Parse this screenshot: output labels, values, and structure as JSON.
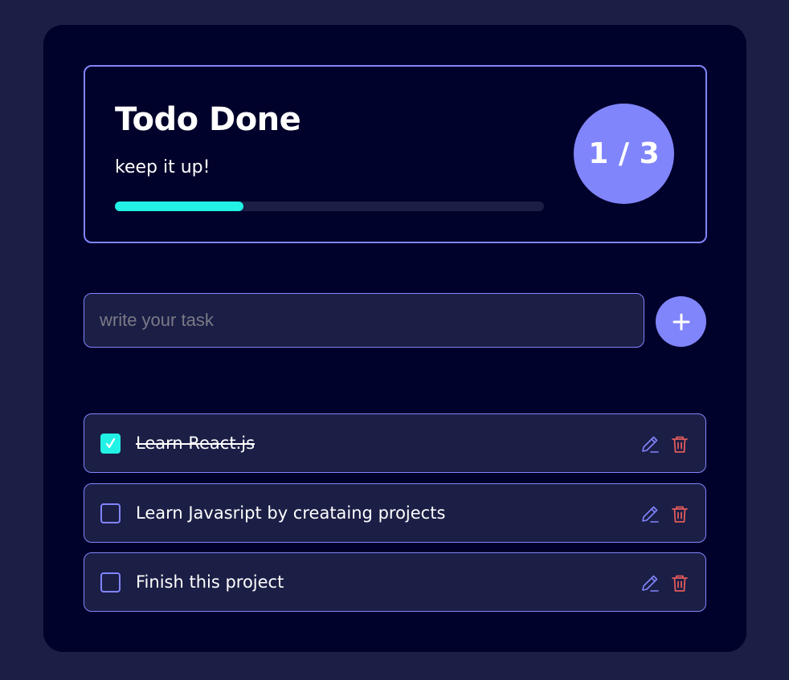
{
  "header": {
    "title": "Todo Done",
    "subtitle": "keep it up!",
    "counter": "1 / 3",
    "progress_fraction": 0.3
  },
  "new_task": {
    "placeholder": "write your task",
    "value": "",
    "add_icon": "plus-icon"
  },
  "todos": [
    {
      "text": "Learn React.js",
      "completed": true
    },
    {
      "text": "Learn Javasript by creataing projects",
      "completed": false
    },
    {
      "text": "Finish this project",
      "completed": false
    }
  ],
  "icons": {
    "edit": "pencil-icon",
    "delete": "trash-icon",
    "check": "check-icon"
  },
  "colors": {
    "page_background": "#1b1e45",
    "app_background": "#00022b",
    "accent": "#8185fb",
    "progress": "#22f2e6",
    "item_background": "#1b1e45",
    "delete": "#e15b5b",
    "text": "#ffffff",
    "placeholder": "#7a7a86"
  }
}
